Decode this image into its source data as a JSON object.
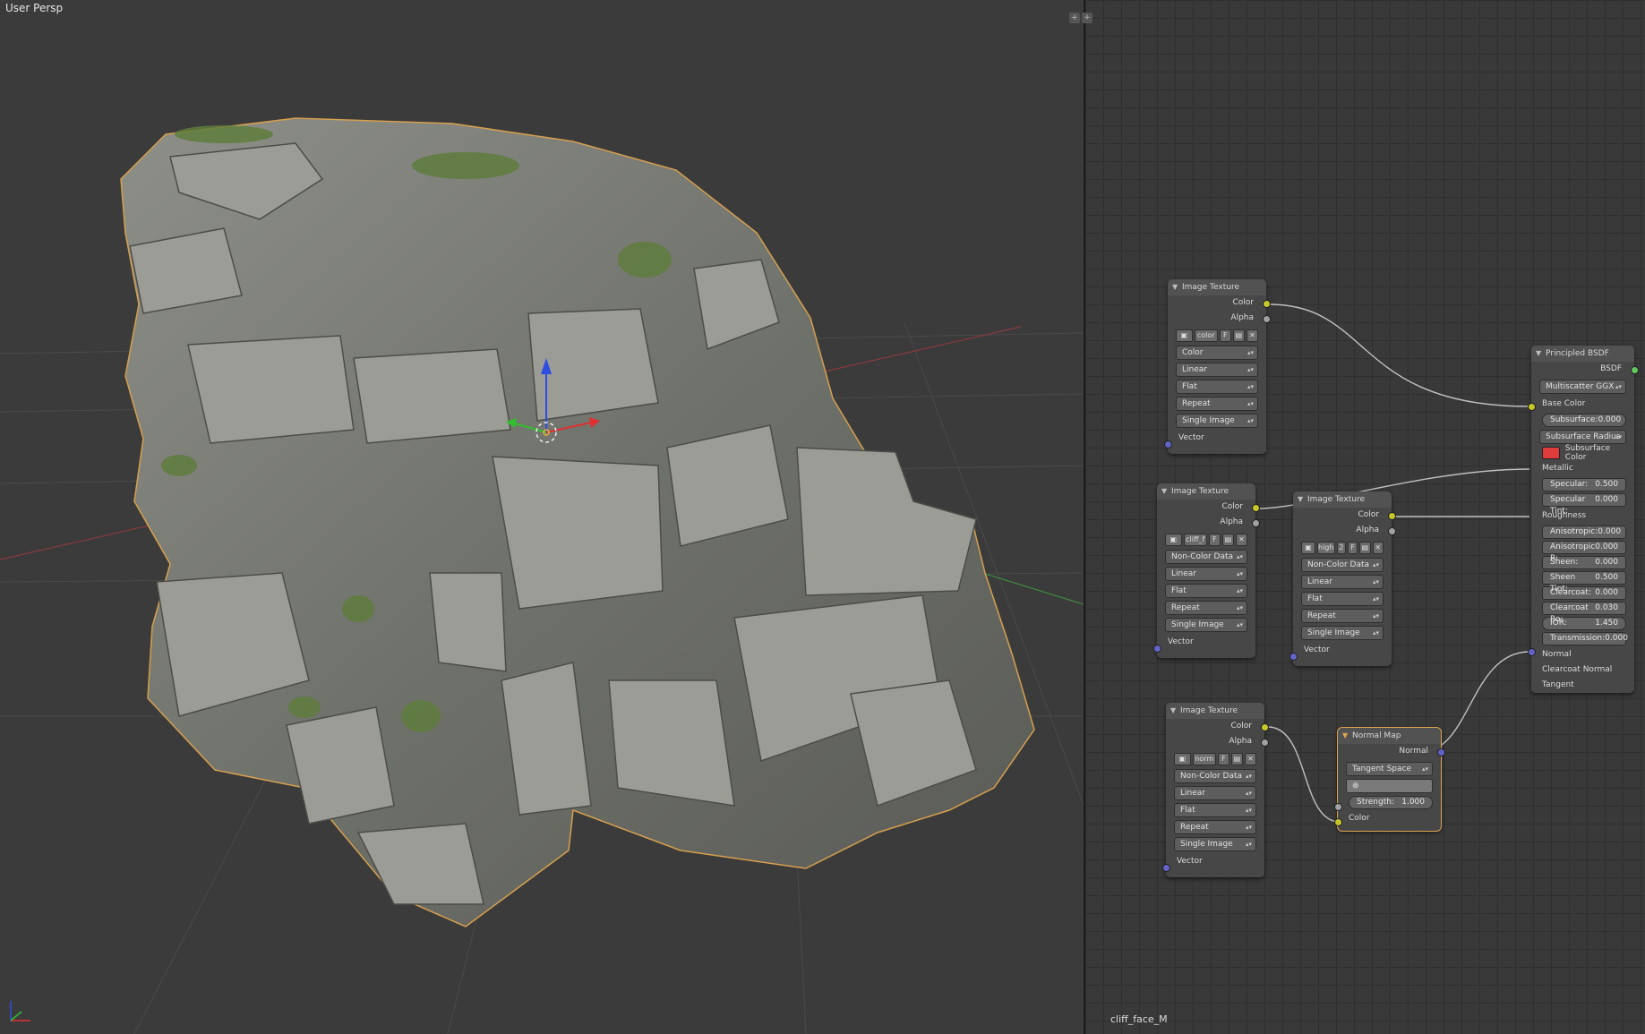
{
  "viewport": {
    "title": "User Persp"
  },
  "material_name": "cliff_face_M",
  "colors": {
    "viewport_bg": "#3b3b3b",
    "node_bg": "#484848",
    "socket_color": "#c7c729",
    "socket_float": "#a1a1a1",
    "socket_vector": "#6363c7",
    "socket_shader": "#63c763",
    "subsurface_color": "#e03c3c",
    "active_outline": "#e0a550"
  },
  "nodes": {
    "img1": {
      "title": "Image Texture",
      "out_color": "Color",
      "out_alpha": "Alpha",
      "image_name": "color",
      "fake_user": "F",
      "color_space": "Color",
      "interpolation": "Linear",
      "projection": "Flat",
      "extension": "Repeat",
      "source": "Single Image",
      "in_vector": "Vector"
    },
    "img2": {
      "title": "Image Texture",
      "out_color": "Color",
      "out_alpha": "Alpha",
      "image_name": "cliff_f",
      "fake_user": "F",
      "color_space": "Non-Color Data",
      "interpolation": "Linear",
      "projection": "Flat",
      "extension": "Repeat",
      "source": "Single Image",
      "in_vector": "Vector"
    },
    "img3": {
      "title": "Image Texture",
      "out_color": "Color",
      "out_alpha": "Alpha",
      "image_name": "high",
      "user_count": "2",
      "fake_user": "F",
      "color_space": "Non-Color Data",
      "interpolation": "Linear",
      "projection": "Flat",
      "extension": "Repeat",
      "source": "Single Image",
      "in_vector": "Vector"
    },
    "img4": {
      "title": "Image Texture",
      "out_color": "Color",
      "out_alpha": "Alpha",
      "image_name": "norm",
      "fake_user": "F",
      "color_space": "Non-Color Data",
      "interpolation": "Linear",
      "projection": "Flat",
      "extension": "Repeat",
      "source": "Single Image",
      "in_vector": "Vector"
    },
    "normal_map": {
      "title": "Normal Map",
      "out_normal": "Normal",
      "space": "Tangent Space",
      "strength_label": "Strength:",
      "strength_value": "1.000",
      "in_color": "Color"
    },
    "principled": {
      "title": "Principled BSDF",
      "out_bsdf": "BSDF",
      "distribution": "Multiscatter GGX",
      "base_color": "Base Color",
      "subsurface_label": "Subsurface:",
      "subsurface_value": "0.000",
      "subsurface_radius": "Subsurface Radius",
      "subsurface_color": "Subsurface Color",
      "metallic": "Metallic",
      "specular_label": "Specular:",
      "specular_value": "0.500",
      "specular_tint_label": "Specular Tint:",
      "specular_tint_value": "0.000",
      "roughness": "Roughness",
      "anisotropic_label": "Anisotropic:",
      "anisotropic_value": "0.000",
      "anisotropic_r_label": "Anisotropic R:",
      "anisotropic_r_value": "0.000",
      "sheen_label": "Sheen:",
      "sheen_value": "0.000",
      "sheen_tint_label": "Sheen Tint:",
      "sheen_tint_value": "0.500",
      "clearcoat_label": "Clearcoat:",
      "clearcoat_value": "0.000",
      "clearcoat_ro_label": "Clearcoat Ro:",
      "clearcoat_ro_value": "0.030",
      "ior_label": "IOR:",
      "ior_value": "1.450",
      "transmission_label": "Transmission:",
      "transmission_value": "0.000",
      "normal": "Normal",
      "clearcoat_normal": "Clearcoat Normal",
      "tangent": "Tangent"
    }
  }
}
